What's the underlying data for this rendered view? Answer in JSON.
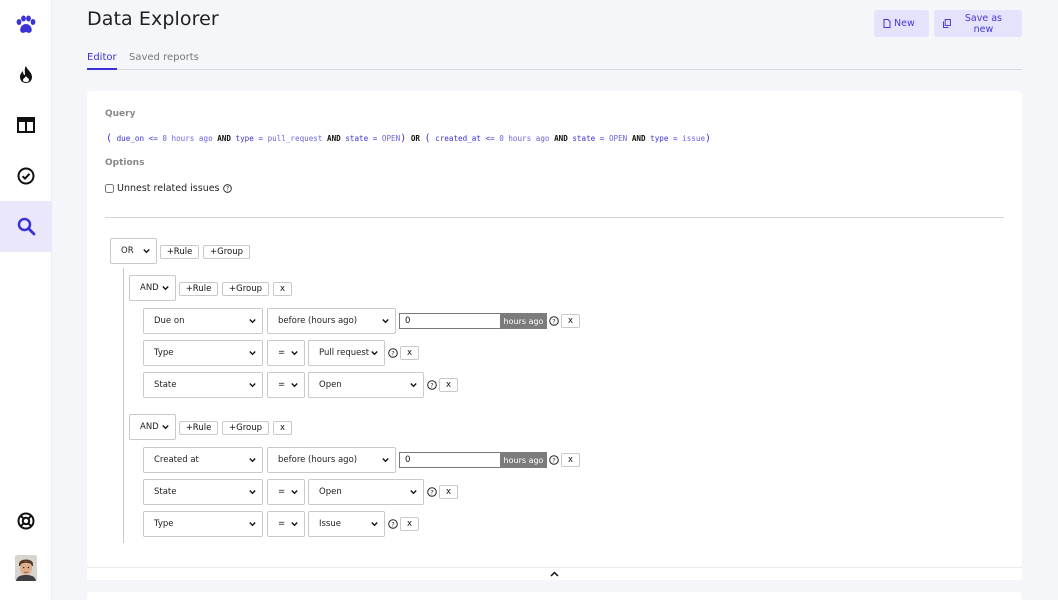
{
  "header": {
    "title": "Data Explorer",
    "new_label": "New",
    "save_as_new_label": "Save as new"
  },
  "tabs": [
    {
      "label": "Editor",
      "active": true
    },
    {
      "label": "Saved reports",
      "active": false
    }
  ],
  "query": {
    "label": "Query",
    "group1": {
      "f1": "due_on",
      "op1": "<=",
      "v1": "0 hours ago",
      "f2": "type",
      "op2": "=",
      "v2": "pull_request",
      "f3": "state",
      "op3": "=",
      "v3": "OPEN"
    },
    "group2": {
      "f1": "created_at",
      "op1": "<=",
      "v1": "0 hours ago",
      "f2": "state",
      "op2": "=",
      "v2": "OPEN",
      "f3": "type",
      "op3": "=",
      "v3": "issue"
    },
    "and": "AND",
    "or": "OR"
  },
  "options": {
    "label": "Options",
    "unnest_label": "Unnest related issues",
    "unnest_checked": false
  },
  "builder": {
    "root_combinator": "OR",
    "add_rule_label": "+Rule",
    "add_group_label": "+Group",
    "remove_label": "x",
    "hours_ago_suffix": "hours ago",
    "groups": [
      {
        "combinator": "AND",
        "rules": [
          {
            "field": "Due on",
            "operator": "before (hours ago)",
            "value": "0"
          },
          {
            "field": "Type",
            "operator": "=",
            "value": "Pull request"
          },
          {
            "field": "State",
            "operator": "=",
            "value": "Open"
          }
        ]
      },
      {
        "combinator": "AND",
        "rules": [
          {
            "field": "Created at",
            "operator": "before (hours ago)",
            "value": "0"
          },
          {
            "field": "State",
            "operator": "=",
            "value": "Open"
          },
          {
            "field": "Type",
            "operator": "=",
            "value": "Issue"
          }
        ]
      }
    ]
  },
  "sidebar": {
    "items": [
      {
        "icon": "paw-icon"
      },
      {
        "icon": "flame-icon"
      },
      {
        "icon": "board-icon"
      },
      {
        "icon": "check-circle-icon"
      },
      {
        "icon": "search-icon",
        "active": true
      },
      {
        "icon": "lifebuoy-icon"
      },
      {
        "icon": "avatar"
      }
    ]
  },
  "colors": {
    "accent": "#3b32d6",
    "accent_light": "#e5e2fb",
    "active_sidebar": "#ebe7fb"
  }
}
